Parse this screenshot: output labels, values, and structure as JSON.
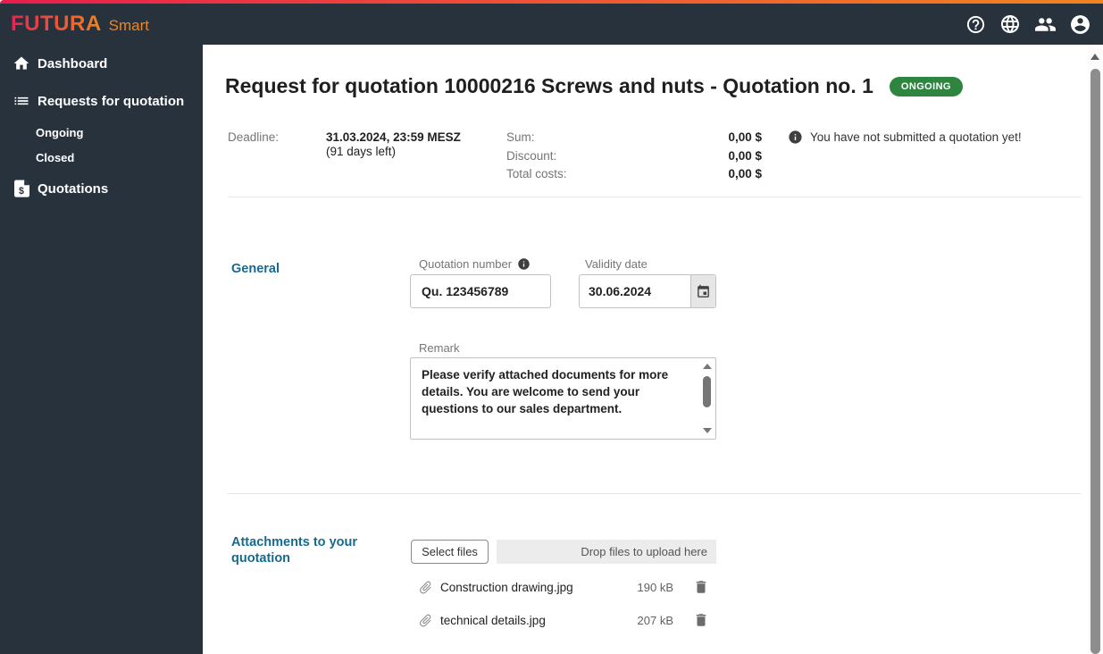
{
  "header": {
    "logo_primary": "FUTURA",
    "logo_secondary": "Smart",
    "icons": [
      "help",
      "language",
      "users",
      "account"
    ]
  },
  "sidebar": {
    "items": [
      {
        "label": "Dashboard",
        "icon": "home"
      },
      {
        "label": "Requests for quotation",
        "icon": "list",
        "children": [
          "Ongoing",
          "Closed"
        ]
      },
      {
        "label": "Quotations",
        "icon": "quote-document"
      }
    ]
  },
  "main": {
    "title": "Request for quotation 10000216 Screws and nuts - Quotation no. 1",
    "status_badge": "ONGOING",
    "summary": {
      "deadline_label": "Deadline:",
      "deadline_value": "31.03.2024, 23:59 MESZ",
      "deadline_note": "(91 days left)",
      "totals": [
        {
          "label": "Sum:",
          "value": "0,00 $"
        },
        {
          "label": "Discount:",
          "value": "0,00 $"
        },
        {
          "label": "Total costs:",
          "value": "0,00 $"
        }
      ],
      "info_message": "You have not submitted a quotation yet!"
    },
    "general": {
      "section_title": "General",
      "quotation_number_label": "Quotation number",
      "quotation_number_value": "Qu. 123456789",
      "validity_date_label": "Validity date",
      "validity_date_value": "30.06.2024",
      "remark_label": "Remark",
      "remark_value": "Please verify attached documents for more details. You are welcome to send your questions to our sales department."
    },
    "attachments": {
      "section_title": "Attachments to your quotation",
      "select_files_label": "Select files",
      "dropzone_label": "Drop files to upload here",
      "files": [
        {
          "name": "Construction drawing.jpg",
          "size": "190 kB"
        },
        {
          "name": "technical details.jpg",
          "size": "207 kB"
        }
      ]
    }
  },
  "colors": {
    "accent_gradient_start": "#ea1c4d",
    "accent_gradient_end": "#f0841f",
    "sidebar_bg": "#28323d",
    "section_heading": "#176a8c",
    "badge_green": "#2e8540"
  }
}
